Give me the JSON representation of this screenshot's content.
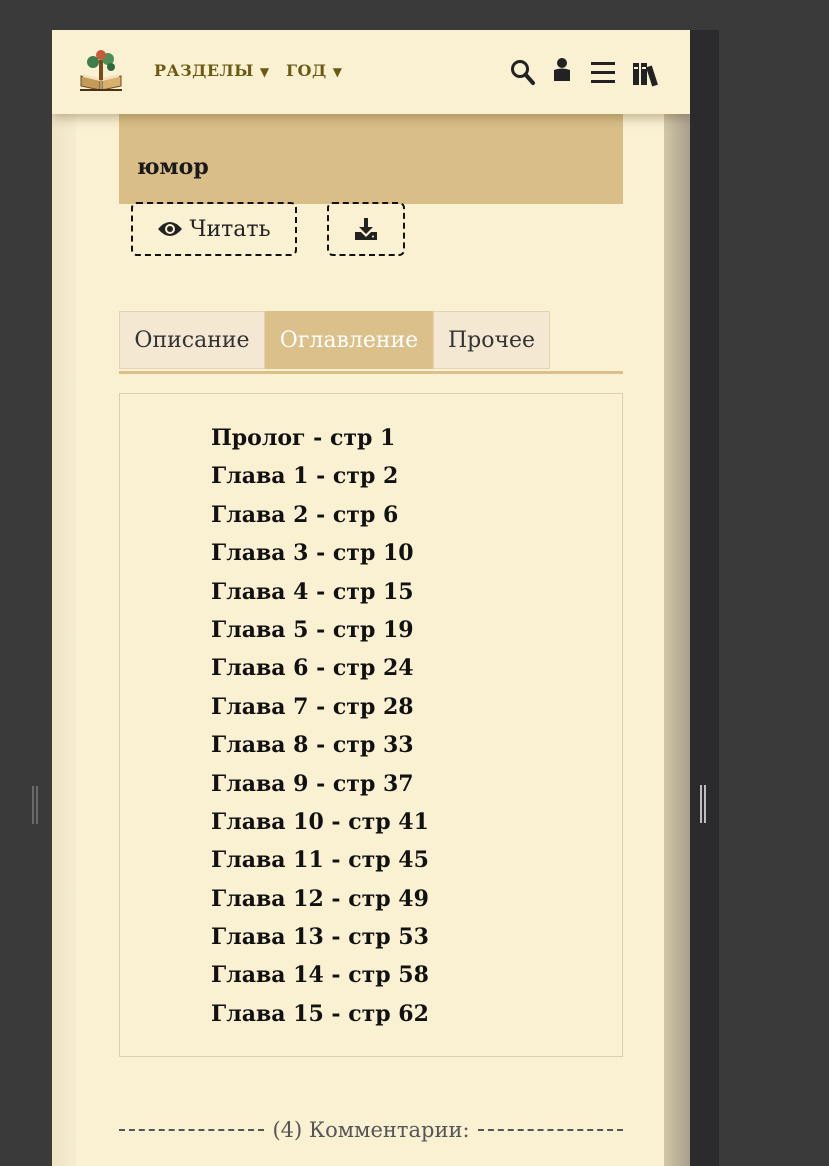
{
  "header": {
    "nav": [
      {
        "label": "РАЗДЕЛЫ",
        "caret": "▼"
      },
      {
        "label": "ГОД",
        "caret": "▼"
      }
    ],
    "icons": [
      "book-logo-icon",
      "search-icon",
      "user-icon",
      "menu-icon",
      "library-icon"
    ],
    "accent_color": "#6b5a12"
  },
  "book": {
    "genre_tail": "юмор"
  },
  "actions": {
    "read_label": "Читать",
    "read_icon": "eye-icon",
    "download_icon": "download-icon"
  },
  "tabs": [
    {
      "label": "Описание",
      "active": false
    },
    {
      "label": "Оглавление",
      "active": true
    },
    {
      "label": "Прочее",
      "active": false
    }
  ],
  "toc": [
    "Пролог - стр 1",
    "Глава 1 - стр 2",
    "Глава 2 - стр 6",
    "Глава 3 - стр 10",
    "Глава 4 - стр 15",
    "Глава 5 - стр 19",
    "Глава 6 - стр 24",
    "Глава 7 - стр 28",
    "Глава 8 - стр 33",
    "Глава 9 - стр 37",
    "Глава 10 - стр 41",
    "Глава 11 - стр 45",
    "Глава 12 - стр 49",
    "Глава 13 - стр 53",
    "Глава 14 - стр 58",
    "Глава 15 - стр 62"
  ],
  "comments": {
    "label": "(4) Комментарии:"
  },
  "colors": {
    "page_bg": "#faf0d2",
    "genre_bg": "#d9bf87",
    "active_tab": "#dcc08a",
    "outer_bg": "#3a3a3a"
  }
}
